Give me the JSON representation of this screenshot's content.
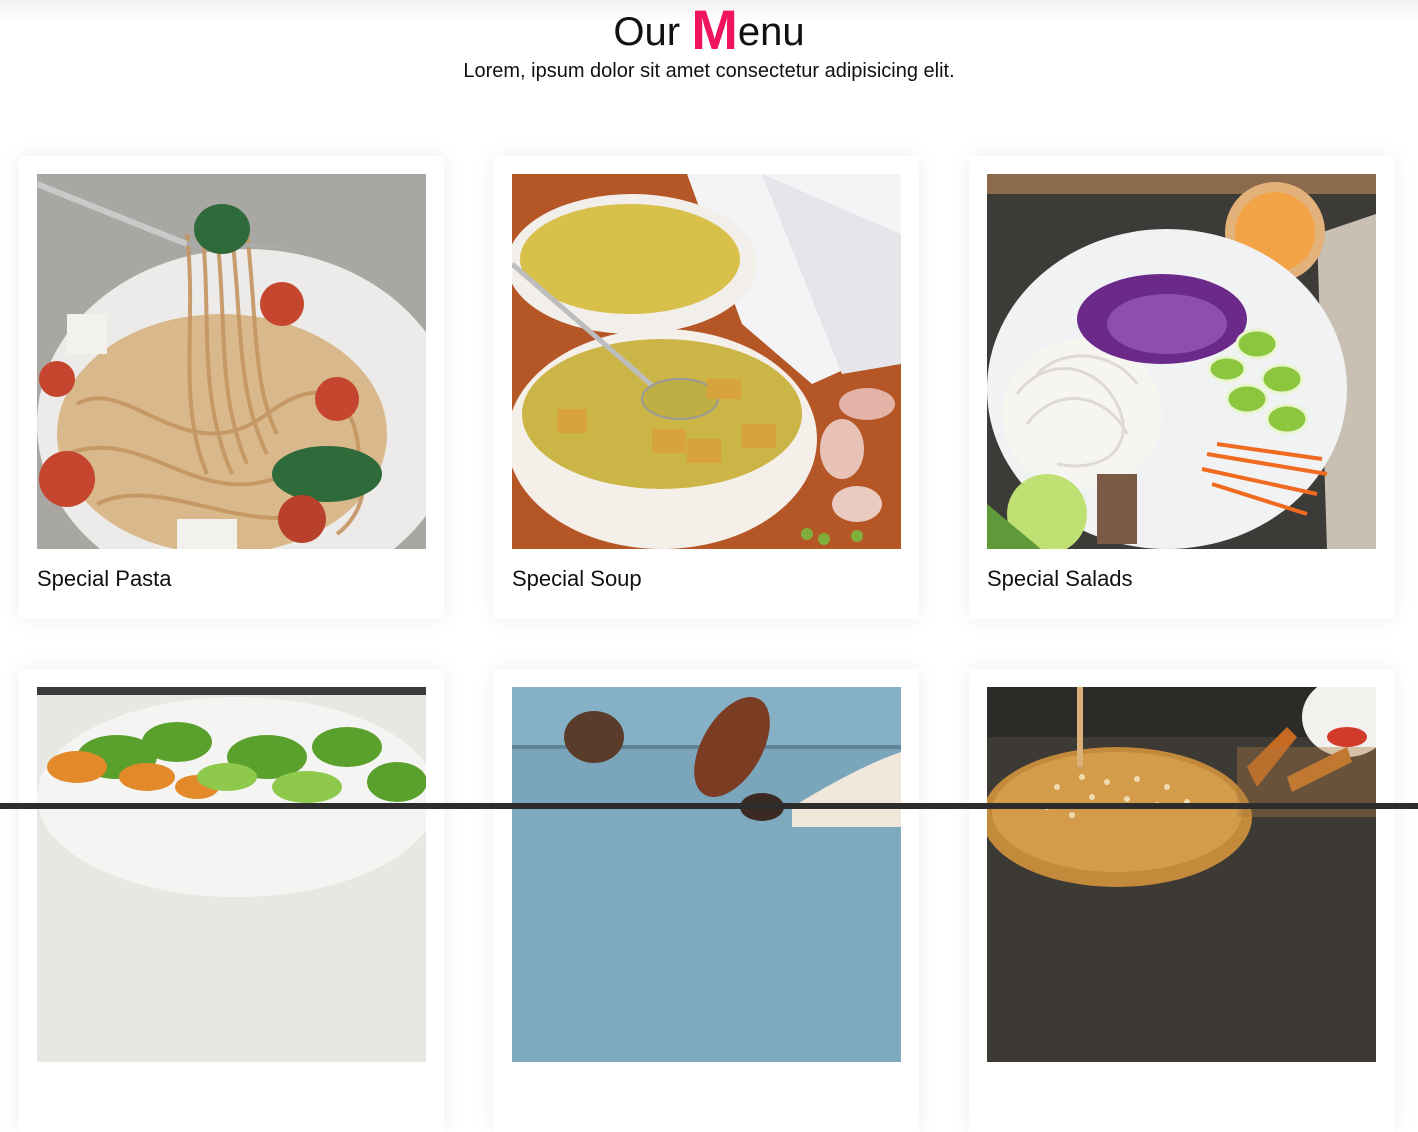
{
  "header": {
    "title_prefix": "Our ",
    "title_accent": "M",
    "title_suffix": "enu",
    "subtitle": "Lorem, ipsum dolor sit amet consectetur adipisicing elit."
  },
  "colors": {
    "accent": "#f0145d",
    "text": "#111111",
    "background": "#ffffff"
  },
  "menu": {
    "items": [
      {
        "label": "Special Pasta",
        "image": "pasta-photo"
      },
      {
        "label": "Special Soup",
        "image": "soup-photo"
      },
      {
        "label": "Special Salads",
        "image": "salad-photo"
      },
      {
        "label": "",
        "image": "green-salad-photo"
      },
      {
        "label": "",
        "image": "wooden-table-photo"
      },
      {
        "label": "",
        "image": "burger-photo"
      }
    ]
  }
}
